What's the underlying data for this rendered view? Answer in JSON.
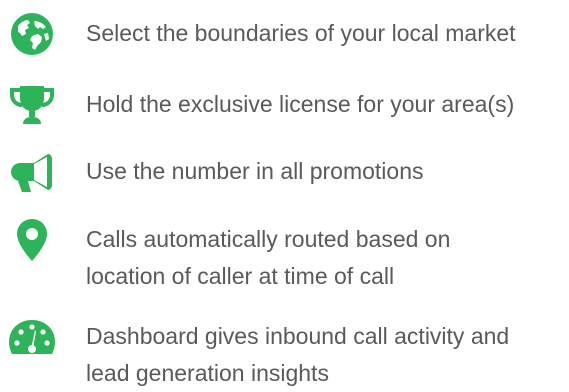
{
  "accent_color": "#2db35a",
  "text_color": "#5a5a5a",
  "features": [
    {
      "icon": "globe-icon",
      "lines": [
        "Select the boundaries of your local market"
      ]
    },
    {
      "icon": "trophy-icon",
      "lines": [
        "Hold the exclusive license for your area(s)"
      ]
    },
    {
      "icon": "megaphone-icon",
      "lines": [
        "Use the number in all promotions"
      ]
    },
    {
      "icon": "map-marker-icon",
      "lines": [
        "Calls automatically routed based on",
        "location of caller at time of call"
      ]
    },
    {
      "icon": "dashboard-gauge-icon",
      "lines": [
        "Dashboard gives inbound call activity and",
        "lead generation insights"
      ]
    }
  ]
}
